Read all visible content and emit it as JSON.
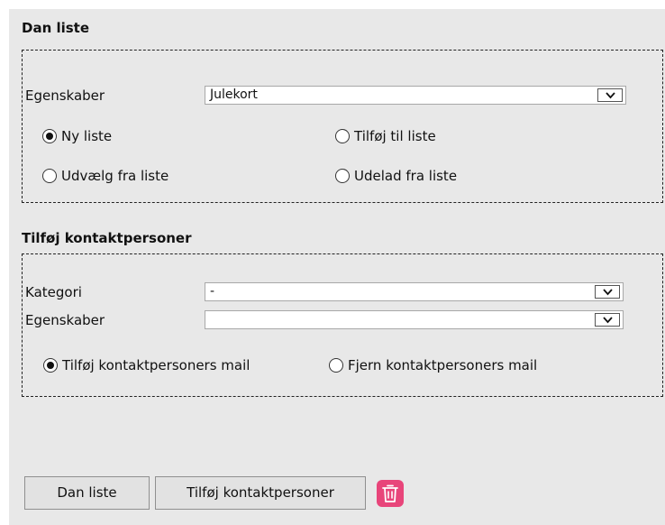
{
  "dan_liste": {
    "title": "Dan liste",
    "egenskaber_label": "Egenskaber",
    "egenskaber_value": "Julekort",
    "options": {
      "ny_liste": "Ny liste",
      "tilfoj_til_liste": "Tilføj til liste",
      "udvaelg_fra_liste": "Udvælg fra liste",
      "udelad_fra_liste": "Udelad fra liste"
    },
    "selected": "ny_liste"
  },
  "tilfoj_kontaktpersoner": {
    "title": "Tilføj kontaktpersoner",
    "kategori_label": "Kategori",
    "kategori_value": "-",
    "egenskaber_label": "Egenskaber",
    "egenskaber_value": "",
    "options": {
      "tilfoj_mail": "Tilføj kontaktpersoners mail",
      "fjern_mail": "Fjern kontaktpersoners mail"
    },
    "selected": "tilfoj_mail"
  },
  "buttons": {
    "dan_liste": "Dan liste",
    "tilfoj_kontaktpersoner": "Tilføj kontaktpersoner"
  },
  "icons": {
    "dropdown": "chevron-down-icon",
    "delete": "trash-icon"
  },
  "colors": {
    "panel_background": "#e8e8e8",
    "delete_button": "#e8457a"
  }
}
